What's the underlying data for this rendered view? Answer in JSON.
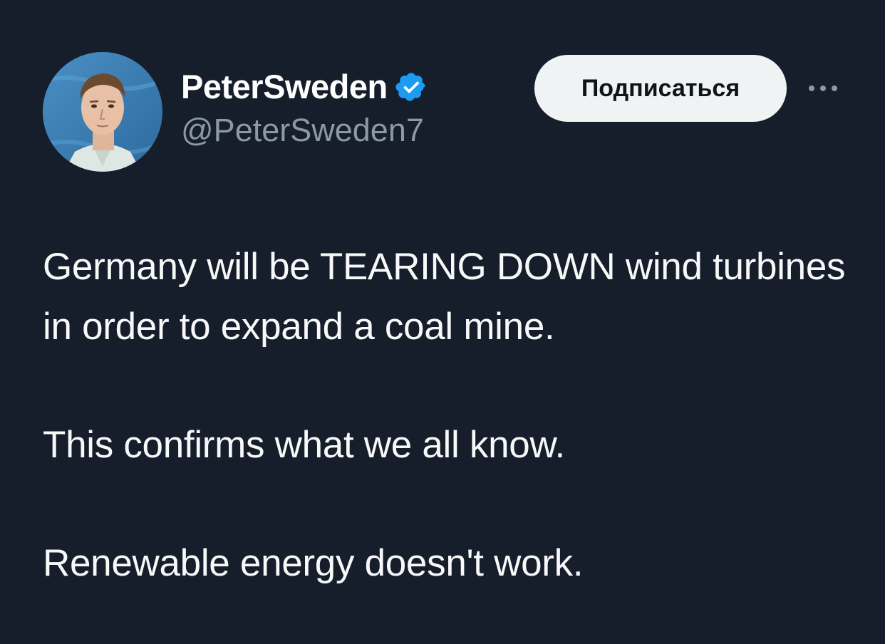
{
  "author": {
    "display_name": "PeterSweden",
    "handle": "@PeterSweden7",
    "verified": true,
    "verified_icon": "verified-badge-icon",
    "avatar_icon": "avatar-photo"
  },
  "actions": {
    "follow_label": "Подписаться",
    "more_icon": "more-options-icon"
  },
  "tweet": {
    "paragraphs": [
      "Germany will be TEARING DOWN wind turbines in order to expand a coal mine.",
      "This confirms what we all know.",
      "Renewable energy doesn't work."
    ]
  },
  "colors": {
    "background": "#161d2b",
    "text": "#f7f9f9",
    "secondary_text": "#8b98a5",
    "verified_blue": "#1d9bf0",
    "follow_button_bg": "#eff3f4"
  }
}
